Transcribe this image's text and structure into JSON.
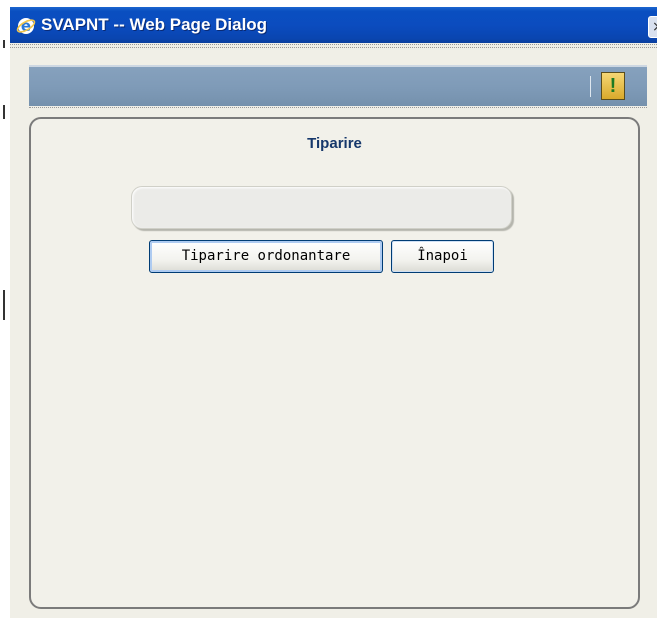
{
  "window": {
    "title": "SVAPNT -- Web Page Dialog",
    "close_glyph": "×"
  },
  "header": {
    "warning_icon": "!"
  },
  "panel": {
    "title": "Tiparire",
    "message": ""
  },
  "buttons": {
    "print_label": "Tiparire ordonantare",
    "back_label": "Înapoi"
  },
  "colors": {
    "titlebar": "#0b4cbf",
    "header_bar": "#7f9bb8",
    "panel_title": "#16386b",
    "warning_green": "#1c7a22"
  }
}
